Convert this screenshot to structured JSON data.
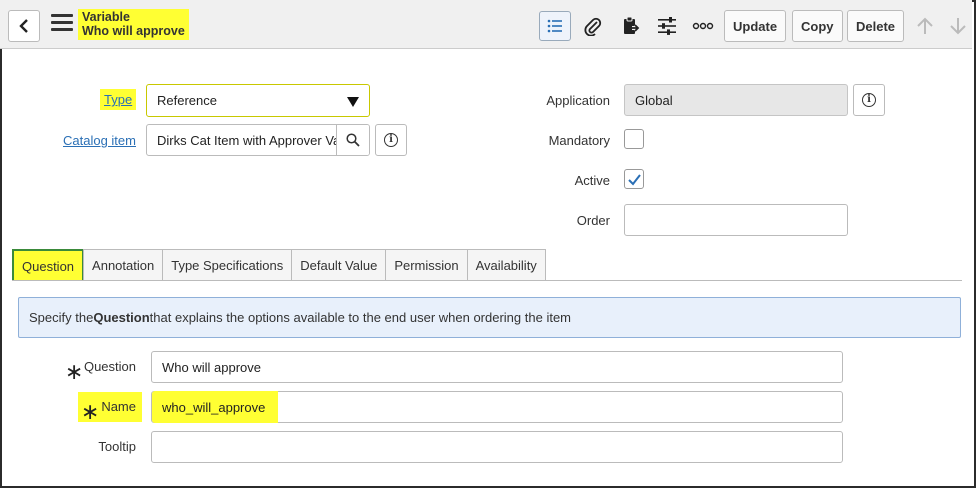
{
  "header": {
    "record_type": "Variable",
    "record_name": "Who will approve",
    "icons": [
      "list-icon",
      "paperclip-icon",
      "clipboard-export-icon",
      "sliders-icon",
      "more-icon"
    ],
    "buttons": {
      "update": "Update",
      "copy": "Copy",
      "delete": "Delete"
    },
    "nav_icons": [
      "arrow-up-icon",
      "arrow-down-icon"
    ]
  },
  "form": {
    "type": {
      "label": "Type",
      "value": "Reference"
    },
    "catalog_item": {
      "label": "Catalog item",
      "value": "Dirks Cat Item with Approver Va"
    },
    "application": {
      "label": "Application",
      "value": "Global"
    },
    "mandatory": {
      "label": "Mandatory",
      "checked": false
    },
    "active": {
      "label": "Active",
      "checked": true
    },
    "order": {
      "label": "Order",
      "value": ""
    }
  },
  "tabs": [
    "Question",
    "Annotation",
    "Type Specifications",
    "Default Value",
    "Permission",
    "Availability"
  ],
  "active_tab": "Question",
  "info": {
    "prefix": "Specify the ",
    "bold": "Question",
    "suffix": " that explains the options available to the end user when ordering the item"
  },
  "question_section": {
    "question": {
      "label": "Question",
      "value": "Who will approve"
    },
    "name": {
      "label": "Name",
      "value": "who_will_approve"
    },
    "tooltip": {
      "label": "Tooltip",
      "value": ""
    }
  },
  "colors": {
    "highlight": "#ffff33",
    "link": "#2a6fb5",
    "check": "#2a6fb5",
    "info_bg": "#e8f0fb"
  }
}
